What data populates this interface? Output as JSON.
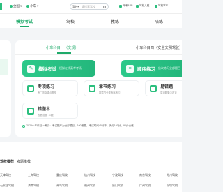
{
  "topbar": {
    "city": "全国",
    "vehicle": "小车",
    "search_category": "驾校",
    "search_placeholder": "请搜索驾校",
    "app_links": [
      "驾考APP",
      "驾校入驻",
      "驾校学车"
    ]
  },
  "nav": {
    "items": [
      "模拟考试",
      "驾校",
      "教练",
      "陪练"
    ],
    "active_index": 0
  },
  "subject_tabs": {
    "active": "小车科目一（交规）",
    "inactive": "小车科目四（安全文明驾驶）"
  },
  "big_buttons": [
    {
      "title": "模拟考试",
      "subtitle": "模拟在线真考考场"
    },
    {
      "title": "顺序练习",
      "subtitle": "依次练习全部题目"
    }
  ],
  "small_buttons": [
    {
      "title": "专项练习",
      "subtitle": "专门攻克重点题型"
    },
    {
      "title": "章节练习",
      "subtitle": "按章节分类有序练习"
    },
    {
      "title": "易错题",
      "subtitle": "易错题集中攻克"
    },
    {
      "title": "错题本",
      "subtitle": "查看错题（0题）"
    }
  ],
  "notice": "2025小车科目一考试：考试题库为全部题目，100道题，考试时间45分钟，满分100分，90分合格。",
  "links": {
    "tabs": [
      "驾校推荐",
      "考题推荐"
    ],
    "cities": [
      [
        "天津驾校",
        "上海驾校",
        "重庆驾校",
        "杭州驾校",
        "宁波驾校",
        "南京驾校",
        "苏州驾校"
      ],
      [
        "石家庄驾校",
        "济南驾校",
        "青岛驾校",
        "福州驾校",
        "厦门驾校",
        "广州驾校",
        "深圳驾校"
      ]
    ]
  },
  "colors": {
    "accent": "#1faa6a",
    "button_green": "#2bbf7e"
  },
  "icons": [
    "location-icon",
    "car-icon",
    "search-icon",
    "mobile-icon",
    "building-icon",
    "steering-icon",
    "exam-icon",
    "list-icon",
    "target-icon",
    "chapter-icon",
    "warning-icon",
    "notebook-icon",
    "info-icon"
  ]
}
